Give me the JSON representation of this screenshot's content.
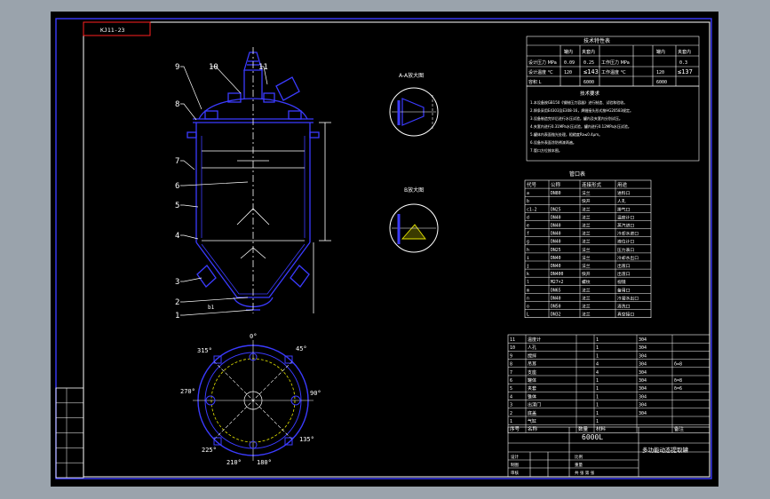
{
  "drawing": {
    "code_box": "KJ11-23",
    "title": "6000L",
    "product_name": "多功能动态提取罐"
  },
  "views": {
    "section_a": "A-A放大图",
    "section_b": "B放大图",
    "bottom_label": "b1"
  },
  "part_callouts": [
    "1",
    "2",
    "3",
    "4",
    "5",
    "6",
    "7",
    "8",
    "9",
    "10",
    "11"
  ],
  "angles": [
    "0°",
    "45°",
    "90°",
    "135°",
    "180°",
    "210°",
    "225°",
    "270°",
    "315°"
  ],
  "tech_table": {
    "title": "技术特性表",
    "header": [
      "",
      "罐内",
      "夹套内",
      "",
      "罐内",
      "夹套内"
    ],
    "rows": [
      [
        "设计压力 MPa",
        "0.09",
        "0.25",
        "工作压力 MPa",
        "",
        "0.3"
      ],
      [
        "设计温度 °C",
        "120",
        "≤143",
        "工作温度 °C",
        "120",
        "≤137"
      ],
      [
        "容积 L",
        "",
        "6000",
        "",
        "",
        "6000"
      ]
    ]
  },
  "tech_notes": {
    "title": "技术要求",
    "items": [
      "1.本设备按GB150《钢制压力容器》进行制造、试验和验收。",
      "2.焊条采用E4303及E308-16，焊缝接头形式按HG20583规定。",
      "3.设备制造完毕后进行水压试验，罐内及夹套内分别试压。",
      "4.夹套内进行0.31MPa水压试验，罐内进行0.12MPa水压试验。",
      "5.罐体内表面抛光处理，粗糙度Ra≤0.4μm。",
      "6.设备外表面涂防锈漆两遍。",
      "7.管口方位按本图。"
    ]
  },
  "nozzle_table": {
    "title": "管口表",
    "header": [
      "代号",
      "公称",
      "连接形式",
      "用途"
    ],
    "rows": [
      [
        "a",
        "DN80",
        "法兰",
        "进料口"
      ],
      [
        "b",
        "",
        "快开",
        "人孔"
      ],
      [
        "c1-2",
        "DN25",
        "法兰",
        "排气口"
      ],
      [
        "d",
        "DN40",
        "法兰",
        "温度计口"
      ],
      [
        "e",
        "DN40",
        "法兰",
        "蒸汽进口"
      ],
      [
        "f",
        "DN40",
        "法兰",
        "冷却水进口"
      ],
      [
        "g",
        "DN40",
        "法兰",
        "液位计口"
      ],
      [
        "h",
        "DN25",
        "法兰",
        "压力表口"
      ],
      [
        "i",
        "DN40",
        "法兰",
        "冷却水出口"
      ],
      [
        "j",
        "DN40",
        "法兰",
        "出液口"
      ],
      [
        "k",
        "DN400",
        "快开",
        "出渣口"
      ],
      [
        "l",
        "M27×2",
        "螺纹",
        "视镜"
      ],
      [
        "m",
        "DN65",
        "法兰",
        "备用口"
      ],
      [
        "n",
        "DN40",
        "法兰",
        "冷凝水出口"
      ],
      [
        "o",
        "DN50",
        "法兰",
        "清洗口"
      ],
      [
        "L",
        "DN32",
        "法兰",
        "真空接口"
      ]
    ]
  },
  "parts_list": {
    "header": [
      "序号",
      "名称",
      "数量",
      "材料",
      "备注"
    ],
    "rows": [
      [
        "11",
        "温度计",
        "1",
        "304",
        ""
      ],
      [
        "10",
        "人孔",
        "1",
        "304",
        ""
      ],
      [
        "9",
        "搅拌",
        "1",
        "304",
        ""
      ],
      [
        "8",
        "吊耳",
        "4",
        "304",
        "δ=8"
      ],
      [
        "7",
        "支座",
        "4",
        "304",
        ""
      ],
      [
        "6",
        "罐体",
        "1",
        "304",
        "δ=8"
      ],
      [
        "5",
        "夹套",
        "1",
        "304",
        "δ=6"
      ],
      [
        "4",
        "锥体",
        "1",
        "304",
        ""
      ],
      [
        "3",
        "出渣门",
        "1",
        "304",
        ""
      ],
      [
        "2",
        "底盖",
        "1",
        "304",
        ""
      ],
      [
        "1",
        "气缸",
        "1",
        "",
        ""
      ]
    ]
  },
  "title_block": {
    "labels": [
      "设计",
      "制图",
      "审核",
      "比例",
      "重量",
      "共 张 第 张"
    ]
  },
  "revision_block": {
    "rows": [
      "",
      "",
      "",
      "",
      "",
      ""
    ]
  },
  "colors": {
    "paper_frame": "#9aa3ac",
    "background": "#000000",
    "line_white": "#ffffff",
    "equipment_blue": "#3b3bff",
    "code_box_red": "#ff2020",
    "detail_yellow": "#e6e600"
  }
}
